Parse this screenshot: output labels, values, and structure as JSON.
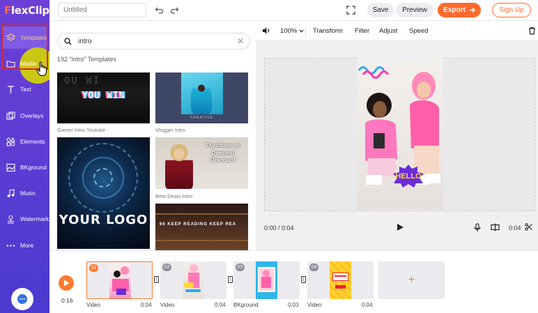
{
  "app": {
    "logo_text": "FlexClip",
    "logo_first_letter": "F",
    "logo_rest": "lexClip"
  },
  "sidebar": {
    "items": [
      {
        "label": "Templates",
        "icon": "layers-icon"
      },
      {
        "label": "Media",
        "icon": "folder-icon"
      },
      {
        "label": "Text",
        "icon": "text-icon"
      },
      {
        "label": "Overlays",
        "icon": "overlays-icon"
      },
      {
        "label": "Elements",
        "icon": "elements-icon"
      },
      {
        "label": "BKground",
        "icon": "background-icon"
      },
      {
        "label": "Music",
        "icon": "music-icon"
      },
      {
        "label": "Watermark",
        "icon": "watermark-icon"
      },
      {
        "label": "More",
        "icon": "more-dots-icon"
      }
    ],
    "active": "Templates"
  },
  "topbar": {
    "title_placeholder": "Untitled",
    "save_label": "Save",
    "preview_label": "Preview",
    "export_label": "Export",
    "signup_label": "Sign Up"
  },
  "templates": {
    "search_value": "intro",
    "count_text": "192 \"intro\" Templates",
    "items": [
      {
        "label": "Gamer Intro Youtube",
        "overlay_text": "YOU WIN",
        "ghost_text": "OU WI"
      },
      {
        "label": "Vlogger Intro",
        "overlay_text": "CREATIVE"
      },
      {
        "label": "",
        "overlay_text": "YOUR LOGO"
      },
      {
        "label": "Best Deals Intro",
        "overlay_text": "Purchase at Deepest Discount"
      },
      {
        "label": "",
        "overlay_text": "66 KEEP READING KEEP REA"
      }
    ]
  },
  "toolbar": {
    "volume_icon": "speaker-icon",
    "zoom_value": "100%",
    "transform_label": "Transform",
    "filter_label": "Filter",
    "adjust_label": "Adjust",
    "speed_label": "Speed"
  },
  "canvas": {
    "sticker_text": "HELLO"
  },
  "player": {
    "current_time": "0:00 / 0:04",
    "duration": "0:04"
  },
  "timeline": {
    "total_time": "0:16",
    "clips": [
      {
        "num": "01",
        "type": "Video",
        "duration": "0:04",
        "selected": true
      },
      {
        "num": "02",
        "type": "Video",
        "duration": "0:04",
        "selected": false
      },
      {
        "num": "03",
        "type": "BKground",
        "duration": "0:03",
        "selected": false
      },
      {
        "num": "04",
        "type": "Video",
        "duration": "0:04",
        "selected": false
      }
    ]
  },
  "colors": {
    "sidebar_top": "#6d3fd6",
    "sidebar_bottom": "#4b3ad0",
    "accent_orange": "#ff6a2c",
    "active_label": "#ffcf7a"
  }
}
